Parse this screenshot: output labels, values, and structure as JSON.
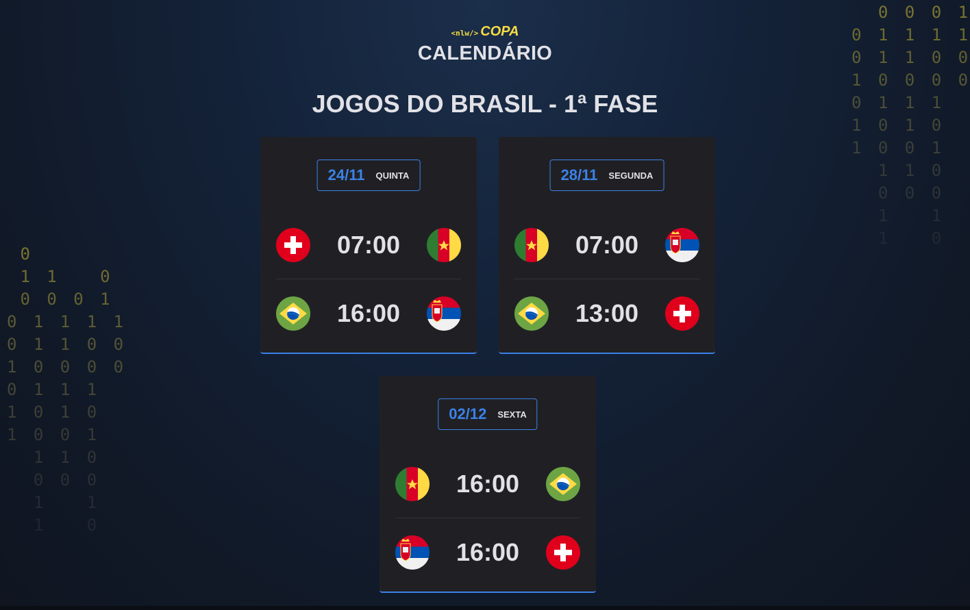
{
  "header": {
    "logo_tag": "<nlw/>",
    "logo_word": "COPA",
    "title": "CALENDÁRIO"
  },
  "section_title": "JOGOS DO BRASIL - 1ª FASE",
  "accent_color": "#3b82e8",
  "logo_color": "#f7dd43",
  "binary_left": [
    " 0",
    " 1 1   0",
    " 0 0 0 1",
    "0 1 1 1 1",
    "0 1 1 0 0",
    "1 0 0 0 0",
    "0 1 1 1",
    "1 0 1 0",
    "1 0 0 1",
    "  1 1 0",
    "  0 0 0",
    "  1   1",
    "  1   0"
  ],
  "binary_right": [
    "  0 0 0 1",
    "0 1 1 1 1",
    "0 1 1 0 0",
    "1 0 0 0 0",
    "0 1 1 1",
    "1 0 1 0",
    "1 0 0 1",
    "  1 1 0",
    "  0 0 0",
    "  1   1",
    "  1   0"
  ],
  "cards": [
    {
      "date": "24/11",
      "weekday": "QUINTA",
      "matches": [
        {
          "home_flag": "switzerland-flag-icon",
          "time": "07:00",
          "away_flag": "cameroon-flag-icon"
        },
        {
          "home_flag": "brazil-flag-icon",
          "time": "16:00",
          "away_flag": "serbia-flag-icon"
        }
      ]
    },
    {
      "date": "28/11",
      "weekday": "SEGUNDA",
      "matches": [
        {
          "home_flag": "cameroon-flag-icon",
          "time": "07:00",
          "away_flag": "serbia-flag-icon"
        },
        {
          "home_flag": "brazil-flag-icon",
          "time": "13:00",
          "away_flag": "switzerland-flag-icon"
        }
      ]
    },
    {
      "date": "02/12",
      "weekday": "SEXTA",
      "matches": [
        {
          "home_flag": "cameroon-flag-icon",
          "time": "16:00",
          "away_flag": "brazil-flag-icon"
        },
        {
          "home_flag": "serbia-flag-icon",
          "time": "16:00",
          "away_flag": "switzerland-flag-icon"
        }
      ]
    }
  ]
}
